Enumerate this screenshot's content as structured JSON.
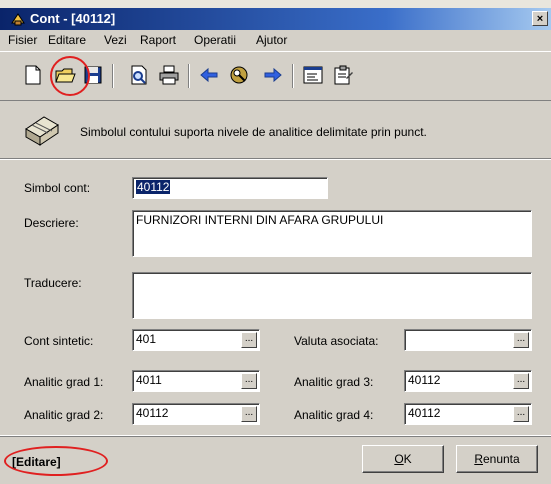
{
  "window": {
    "title": "Cont - [40112]",
    "close_glyph": "×"
  },
  "menu": [
    {
      "label": "Fisier"
    },
    {
      "label": "Editare"
    },
    {
      "label": "Vezi"
    },
    {
      "label": "Raport"
    },
    {
      "label": "Operatii"
    },
    {
      "label": "Ajutor"
    }
  ],
  "toolbar": {
    "icons": [
      "new-document-icon",
      "open-folder-icon",
      "save-icon",
      "print-preview-icon",
      "print-icon",
      "back-arrow-icon",
      "search-globe-icon",
      "forward-arrow-icon",
      "properties-icon",
      "notes-icon"
    ]
  },
  "info": {
    "text": "Simbolul contului suporta nivele de analitice delimitate prin punct."
  },
  "form": {
    "simbol_label": "Simbol cont:",
    "simbol_value": "40112",
    "descriere_label": "Descriere:",
    "descriere_value": "FURNIZORI INTERNI DIN AFARA GRUPULUI",
    "traducere_label": "Traducere:",
    "traducere_value": "",
    "cont_sintetic_label": "Cont sintetic:",
    "cont_sintetic_value": "401",
    "valuta_label": "Valuta asociata:",
    "valuta_value": "",
    "an1_label": "Analitic grad 1:",
    "an1_value": "4011",
    "an2_label": "Analitic grad 2:",
    "an2_value": "40112",
    "an3_label": "Analitic grad 3:",
    "an3_value": "40112",
    "an4_label": "Analitic grad 4:",
    "an4_value": "40112",
    "dots": "..."
  },
  "status": {
    "mode": "[Editare]",
    "ok_hot": "O",
    "ok_rest": "K",
    "cancel_hot": "R",
    "cancel_rest": "enunta"
  },
  "colors": {
    "title_start": "#0a246a",
    "title_end": "#a6caf0",
    "face": "#d4d0c8",
    "highlight_ring": "#e02020",
    "selection": "#0a246a"
  }
}
